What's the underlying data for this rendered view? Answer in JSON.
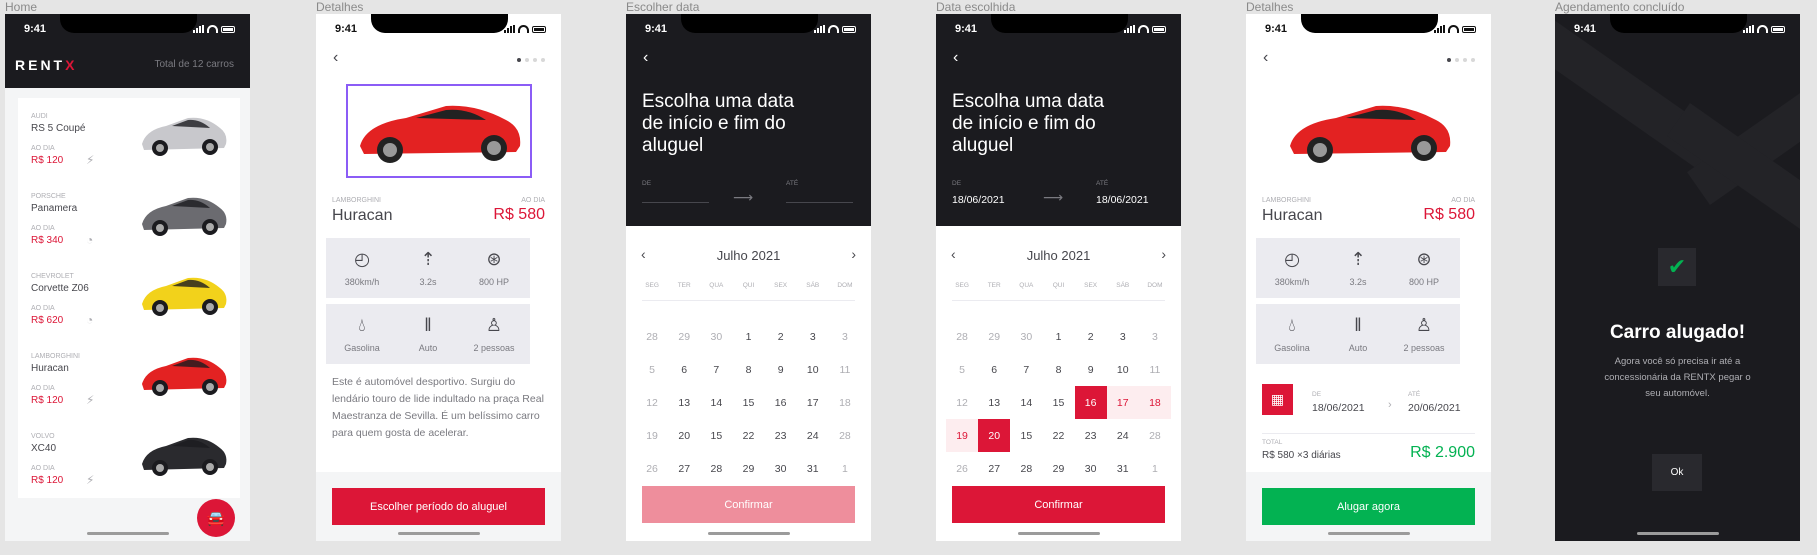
{
  "status": {
    "time": "9:41"
  },
  "frames": [
    {
      "label": "Home"
    },
    {
      "label": "Detalhes"
    },
    {
      "label": "Escolher data"
    },
    {
      "label": "Data escolhida"
    },
    {
      "label": "Detalhes"
    },
    {
      "label": "Agendamento concluído"
    }
  ],
  "home": {
    "logo_main": "RENT",
    "logo_accent": "X",
    "total": "Total de 12 carros",
    "cars": [
      {
        "brand": "AUDI",
        "name": "RS 5 Coupé",
        "period": "AO DIA",
        "price": "R$ 120",
        "fuel": "energy-icon",
        "color": "#c8c8cc"
      },
      {
        "brand": "PORSCHE",
        "name": "Panamera",
        "period": "AO DIA",
        "price": "R$ 340",
        "fuel": "drop-icon",
        "color": "#6b6b70"
      },
      {
        "brand": "CHEVROLET",
        "name": "Corvette Z06",
        "period": "AO DIA",
        "price": "R$ 620",
        "fuel": "drop-icon",
        "color": "#f2d21b"
      },
      {
        "brand": "LAMBORGHINI",
        "name": "Huracan",
        "period": "AO DIA",
        "price": "R$ 120",
        "fuel": "energy-icon",
        "color": "#e32222"
      },
      {
        "brand": "VOLVO",
        "name": "XC40",
        "period": "AO DIA",
        "price": "R$ 120",
        "fuel": "energy-icon",
        "color": "#2a2a2e"
      }
    ]
  },
  "details": {
    "brand": "LAMBORGHINI",
    "name": "Huracan",
    "period": "AO DIA",
    "price": "R$ 580",
    "specs": [
      {
        "icon": "speedometer-icon",
        "label": "380km/h"
      },
      {
        "icon": "acceleration-icon",
        "label": "3.2s"
      },
      {
        "icon": "steering-wheel-icon",
        "label": "800 HP"
      },
      {
        "icon": "fuel-drop-icon",
        "label": "Gasolina"
      },
      {
        "icon": "gearshift-icon",
        "label": "Auto"
      },
      {
        "icon": "people-icon",
        "label": "2 pessoas"
      }
    ],
    "about": "Este é automóvel desportivo. Surgiu do lendário touro de lide indultado na praça Real Maestranza de Sevilla. É um belíssimo carro para quem gosta de acelerar.",
    "cta": "Escolher período do aluguel",
    "cta_color": "#dc1637"
  },
  "calendar": {
    "title": "Escolha uma data de início e fim do aluguel",
    "from_label": "DE",
    "to_label": "ATÉ",
    "month": "Julho 2021",
    "weekdays": [
      "SEG",
      "TER",
      "QUA",
      "QUI",
      "SEX",
      "SÁB",
      "DOM"
    ],
    "days": [
      "28",
      "29",
      "30",
      "1",
      "2",
      "3",
      "3",
      "5",
      "6",
      "7",
      "8",
      "9",
      "10",
      "11",
      "12",
      "13",
      "14",
      "15",
      "16",
      "17",
      "18",
      "19",
      "20",
      "15",
      "22",
      "23",
      "24",
      "28",
      "26",
      "27",
      "28",
      "29",
      "30",
      "31",
      "1"
    ],
    "confirm": "Confirmar",
    "confirm_disabled_color": "#ee8e9c"
  },
  "calendar_selected": {
    "from_value": "18/06/2021",
    "to_value": "18/06/2021",
    "confirm_color": "#dc1637"
  },
  "schedule": {
    "from_label": "DE",
    "from_value": "18/06/2021",
    "to_label": "ATÉ",
    "to_value": "20/06/2021",
    "total_label": "TOTAL",
    "total_desc": "R$ 580 ×3 diárias",
    "total_value": "R$ 2.900",
    "cta": "Alugar agora",
    "cta_color": "#03b252"
  },
  "done": {
    "title": "Carro alugado!",
    "message": "Agora você só precisa ir até a concessionária da RENTX pegar o seu automóvel.",
    "ok": "Ok"
  }
}
